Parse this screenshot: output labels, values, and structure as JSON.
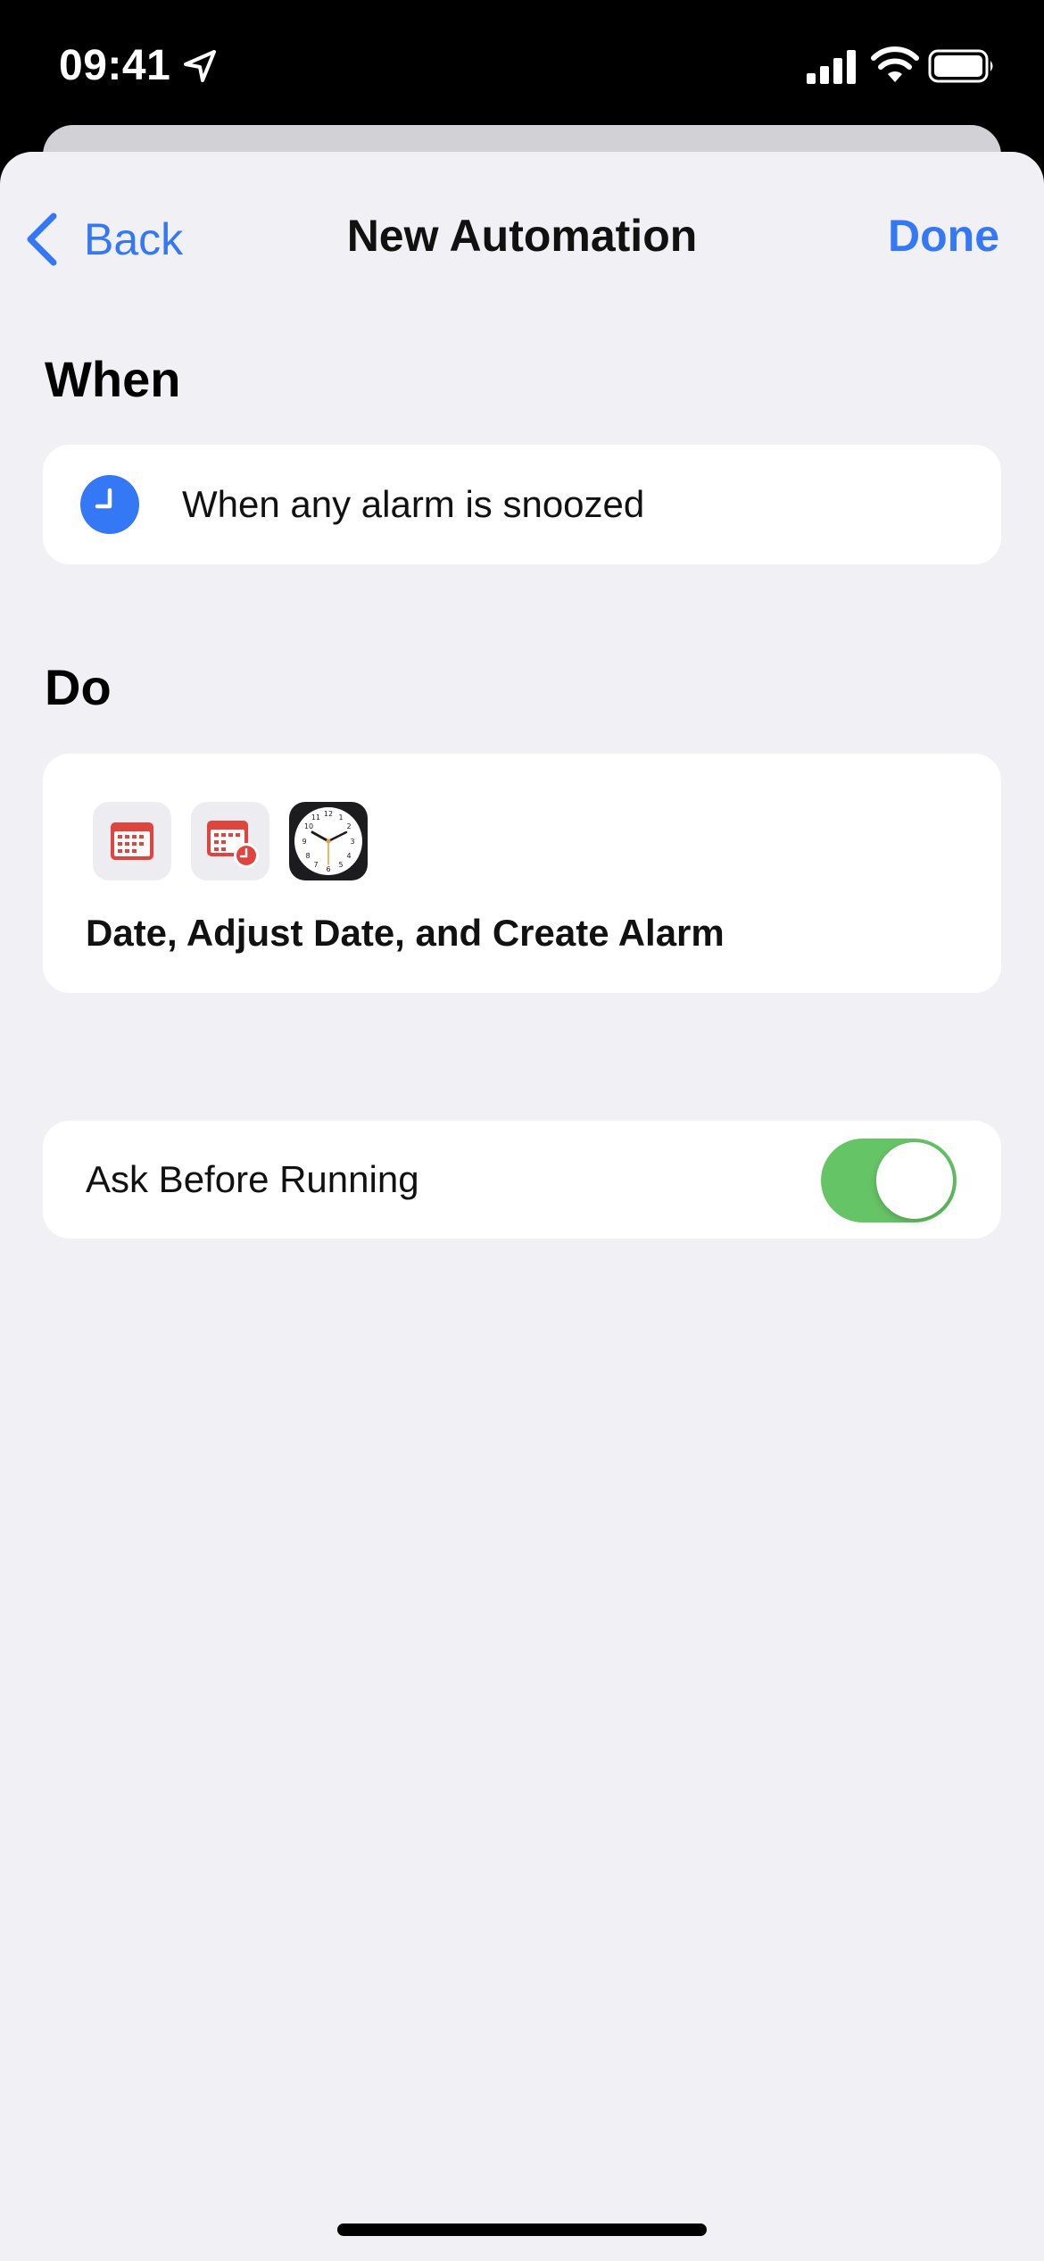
{
  "status_bar": {
    "time": "09:41",
    "icons": [
      "location-arrow-icon",
      "cellular-signal-icon",
      "wifi-icon",
      "battery-icon"
    ]
  },
  "nav": {
    "back_label": "Back",
    "title": "New Automation",
    "done_label": "Done",
    "back_icon": "chevron-left-icon"
  },
  "when_section": {
    "title": "When",
    "trigger_text": "When any alarm is snoozed",
    "trigger_icon": "clock-icon"
  },
  "do_section": {
    "title": "Do",
    "actions_summary": "Date, Adjust Date, and Create Alarm",
    "action_icons": [
      "calendar-icon",
      "calendar-clock-icon",
      "clock-app-icon"
    ]
  },
  "options": {
    "ask_before_running_label": "Ask Before Running",
    "ask_before_running_on": true
  },
  "colors": {
    "accent": "#3478f6",
    "toggle_on": "#65c466",
    "background": "#f0f0f5",
    "card": "#ffffff",
    "calendar_red": "#e0443e"
  }
}
